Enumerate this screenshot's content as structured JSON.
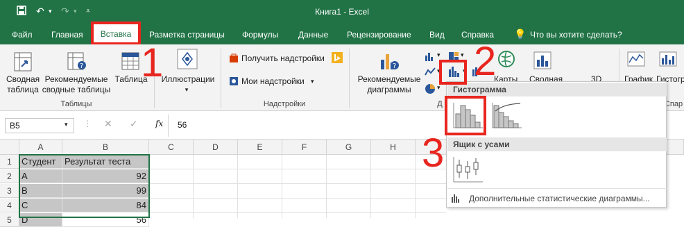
{
  "titlebar": {
    "title": "Книга1  -  Excel"
  },
  "tabs": [
    "Файл",
    "Главная",
    "Вставка",
    "Разметка страницы",
    "Формулы",
    "Данные",
    "Рецензирование",
    "Вид",
    "Справка"
  ],
  "tell_me": "Что вы хотите сделать?",
  "ribbon": {
    "tables": {
      "pivot_line1": "Сводная",
      "pivot_line2": "таблица",
      "recommended_line1": "Рекомендуемые",
      "recommended_line2": "сводные таблицы",
      "table": "Таблица",
      "group_label": "Таблицы"
    },
    "illustrations": {
      "label": "Иллюстрации"
    },
    "addins": {
      "get_addins": "Получить надстройки",
      "my_addins": "Мои надстройки",
      "group_label": "Надстройки"
    },
    "charts": {
      "recommended_line1": "Рекомендуемые",
      "recommended_line2": "диаграммы",
      "maps": "Карты",
      "pivot_chart": "Сводная",
      "group_label_cut": "Д",
      "chart_3d": "3D",
      "sparkline_graph": "График",
      "sparkline_hist": "Гистогр",
      "sparkline_group_cut": "Спар"
    }
  },
  "formula_bar": {
    "name_box": "B5",
    "fx": "fx",
    "value": "56"
  },
  "grid": {
    "columns": [
      "A",
      "B",
      "C",
      "D",
      "E",
      "F",
      "G",
      "H"
    ],
    "rows": [
      {
        "num": "1",
        "a": "Студент",
        "b": "Результат теста"
      },
      {
        "num": "2",
        "a": "A",
        "b": "92"
      },
      {
        "num": "3",
        "a": "B",
        "b": "99"
      },
      {
        "num": "4",
        "a": "C",
        "b": "84"
      },
      {
        "num": "5",
        "a": "D",
        "b": "56"
      }
    ]
  },
  "dropdown": {
    "histogram_header": "Гистограмма",
    "boxwhisker_header": "Ящик с усами",
    "more_link": "Дополнительные статистические диаграммы..."
  },
  "annotations": [
    "1",
    "2",
    "3"
  ],
  "colors": {
    "excel_green": "#217346",
    "annotation_red": "#e8261f"
  }
}
